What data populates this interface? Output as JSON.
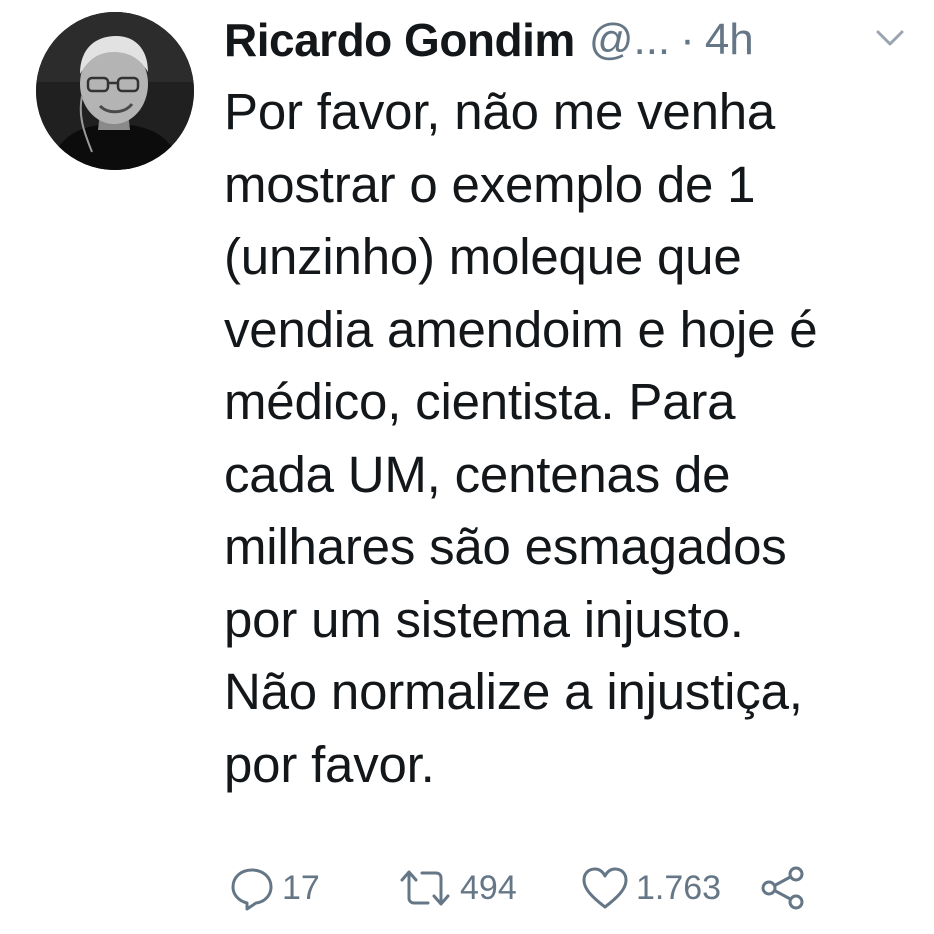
{
  "tweet": {
    "author_name": "Ricardo Gondim",
    "handle": "@...",
    "separator": "·",
    "time": "4h",
    "text": "Por favor, não me venha\nmostrar o exemplo de 1\n(unzinho) moleque que\nvendia amendoim e hoje é\nmédico, cientista. Para\ncada UM, centenas de\nmilhares são esmagados\npor um sistema injusto.\nNão normalize a injustiça,\npor favor.",
    "menu_icon": "chevron-down-icon"
  },
  "actions": {
    "reply": {
      "icon": "reply-icon",
      "count": "17"
    },
    "retweet": {
      "icon": "retweet-icon",
      "count": "494"
    },
    "like": {
      "icon": "heart-icon",
      "count": "1.763"
    },
    "share": {
      "icon": "share-icon"
    }
  },
  "colors": {
    "text": "#14171a",
    "secondary": "#657786",
    "background": "#ffffff"
  }
}
